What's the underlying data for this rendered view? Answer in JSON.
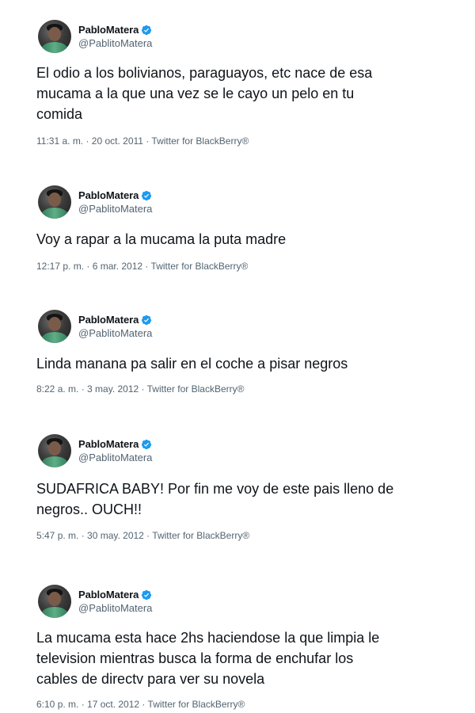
{
  "tweets": [
    {
      "author_name": "PabloMatera",
      "author_handle": "@PablitoMatera",
      "text": "El odio a los bolivianos, paraguayos, etc nace de esa\nmucama a la que una vez se le cayo un pelo en tu\ncomida",
      "meta": "11:31 a. m. · 20 oct. 2011 · Twitter for BlackBerry®"
    },
    {
      "author_name": "PabloMatera",
      "author_handle": "@PablitoMatera",
      "text": "Voy a rapar a la mucama la puta madre",
      "meta": "12:17 p. m. · 6 mar. 2012 · Twitter for BlackBerry®"
    },
    {
      "author_name": "PabloMatera",
      "author_handle": "@PablitoMatera",
      "text": "Linda manana pa salir en el coche a pisar negros",
      "meta": "8:22 a. m. · 3 may. 2012 · Twitter for BlackBerry®"
    },
    {
      "author_name": "PabloMatera",
      "author_handle": "@PablitoMatera",
      "text": "SUDAFRICA BABY! Por fin me voy de este pais lleno de\nnegros.. OUCH!!",
      "meta": "5:47 p. m. · 30 may. 2012 · Twitter for BlackBerry®"
    },
    {
      "author_name": "PabloMatera",
      "author_handle": "@PablitoMatera",
      "text": "La mucama esta hace 2hs haciendose la que limpia le\ntelevision mientras busca la forma de enchufar los\ncables de directv para ver su novela",
      "meta": "6:10 p. m. · 17 oct. 2012 · Twitter for BlackBerry®"
    }
  ],
  "colors": {
    "verified_badge": "#1d9bf0",
    "text_primary": "#0f1419",
    "text_secondary": "#536471"
  },
  "icons": {
    "verified": "verified-badge-icon"
  }
}
